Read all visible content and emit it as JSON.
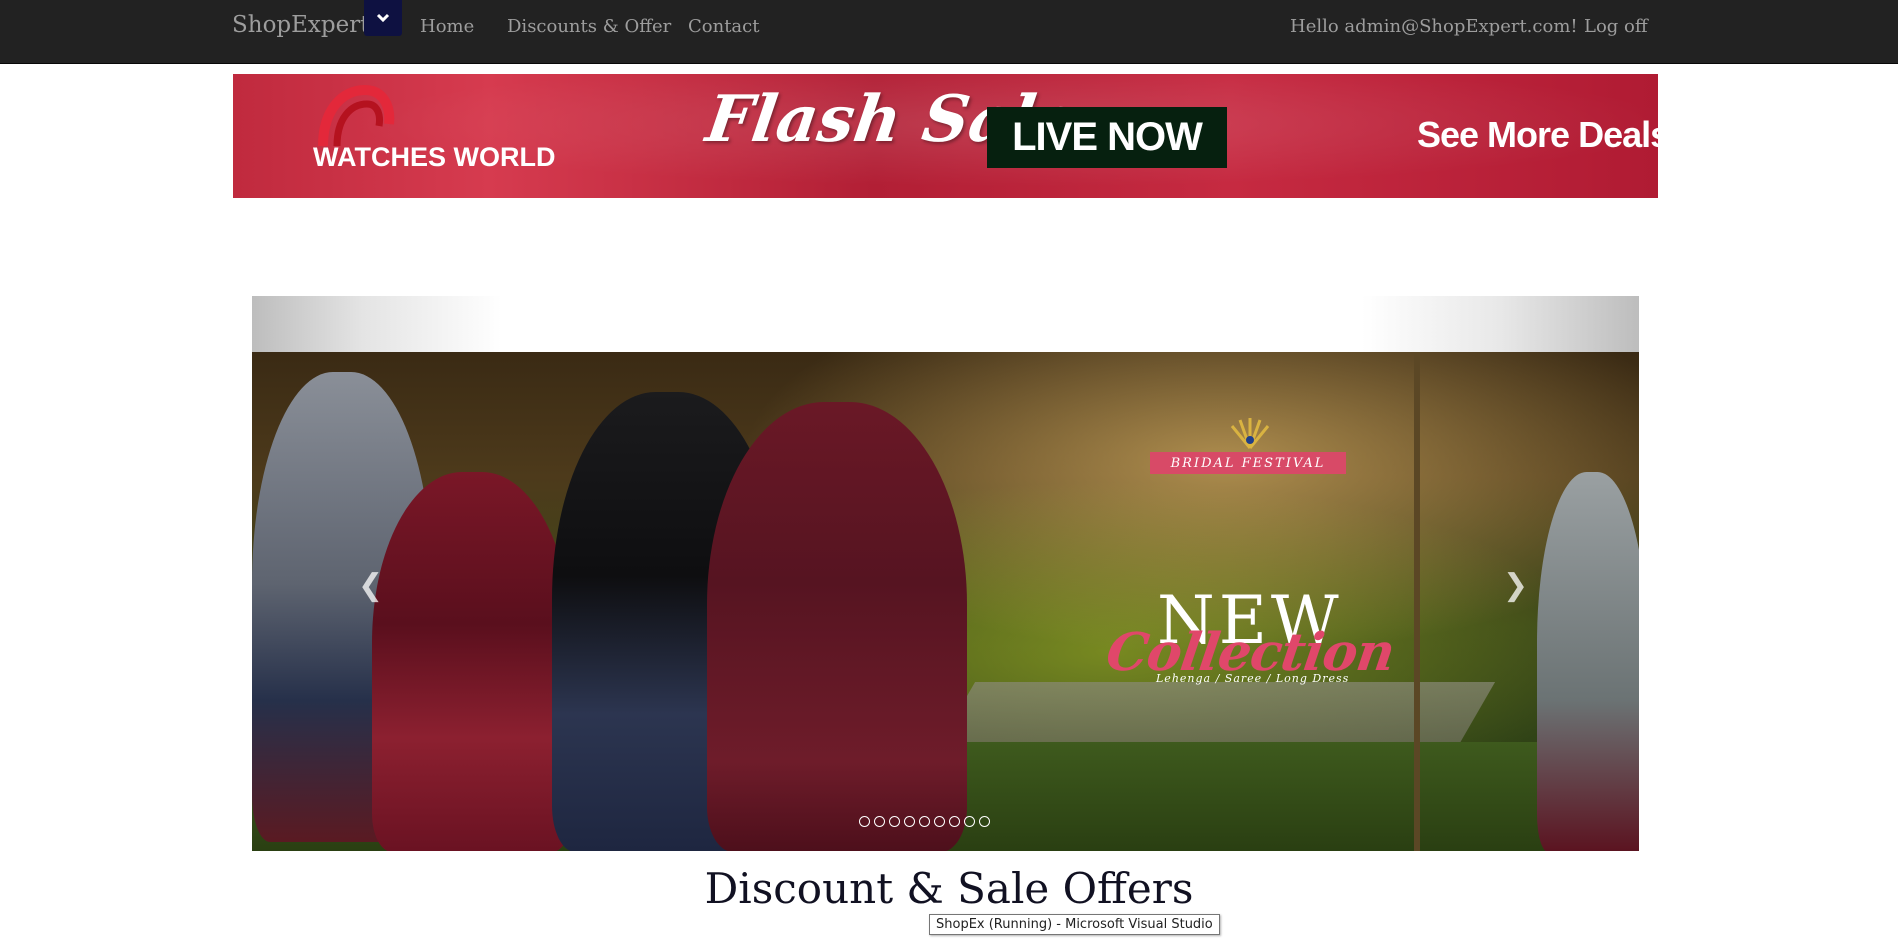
{
  "navbar": {
    "brand": "ShopExpert",
    "links": [
      "Home",
      "Discounts & Offer",
      "Contact"
    ],
    "greeting": "Hello admin@ShopExpert.com!",
    "logoff": "Log off",
    "toggle_icon": "chevron-down-icon"
  },
  "banner": {
    "brand": "WATCHES WORLD",
    "headline": "Flash Sale",
    "badge": "LIVE NOW",
    "cta": "See More Deals ››",
    "colors": {
      "background": "#c02a3e",
      "badge": "#06200f"
    }
  },
  "carousel": {
    "slide": {
      "tag": "BRIDAL FESTIVAL",
      "title": "NEW",
      "subtitle": "Collection",
      "caption": "Lehenga / Saree / Long Dress"
    },
    "prev_icon": "chevron-left-icon",
    "next_icon": "chevron-right-icon",
    "indicator_count": 9
  },
  "section": {
    "heading": "Discount & Sale Offers"
  },
  "tooltip": {
    "text": "ShopEx (Running) - Microsoft Visual Studio"
  }
}
